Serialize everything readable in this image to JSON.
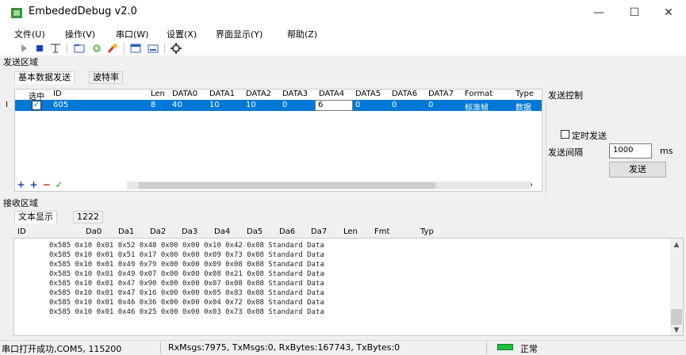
{
  "window": {
    "title": "EmbededDebug v2.0"
  },
  "menu": [
    "文件(U)",
    "操作(V)",
    "串口(W)",
    "设置(X)",
    "界面显示(Y)",
    "帮助(Z)"
  ],
  "toolbar": [
    "play-icon",
    "stop-icon",
    "antenna-icon",
    "open-folder-icon",
    "refresh-icon",
    "brush-icon",
    "window-icon",
    "window-minimize-icon",
    "settings-icon"
  ],
  "send": {
    "title": "发送区域",
    "tabs": [
      "基本数据发送",
      "波特率"
    ],
    "columns": [
      "选中",
      "ID",
      "Len",
      "DATA0",
      "DATA1",
      "DATA2",
      "DATA3",
      "DATA4",
      "DATA5",
      "DATA6",
      "DATA7",
      "Format",
      "Type"
    ],
    "row": {
      "marker": "I",
      "checked": true,
      "id": "605",
      "len": "8",
      "data": [
        "40",
        "10",
        "10",
        "0",
        "6",
        "0",
        "0",
        "0"
      ],
      "format": "标准帧",
      "type": "数据"
    }
  },
  "control": {
    "title": "发送控制",
    "timer_label": "定时发送",
    "interval_label": "发送间隔",
    "interval_value": "1000",
    "unit": "ms",
    "send_label": "发送"
  },
  "recv": {
    "title": "接收区域",
    "tabs": [
      "文本显示",
      "1222"
    ],
    "columns": [
      "ID",
      "Da0",
      "Da1",
      "Da2",
      "Da3",
      "Da4",
      "Da5",
      "Da6",
      "Da7",
      "Len",
      "Fmt",
      "Typ"
    ],
    "lines": [
      "0x585 0x10 0x01 0x52 0x48 0x00 0x00 0x10 0x42 0x08 Standard Data",
      "0x585 0x10 0x01 0x51 0x17 0x00 0x00 0x09 0x73 0x08 Standard Data",
      "0x585 0x10 0x01 0x49 0x79 0x00 0x00 0x09 0x08 0x08 Standard Data",
      "0x585 0x10 0x01 0x49 0x07 0x00 0x00 0x08 0x21 0x08 Standard Data",
      "0x585 0x10 0x01 0x47 0x90 0x00 0x00 0x07 0x08 0x08 Standard Data",
      "0x585 0x10 0x01 0x47 0x16 0x00 0x00 0x05 0x83 0x08 Standard Data",
      "0x585 0x10 0x01 0x46 0x36 0x00 0x00 0x04 0x72 0x08 Standard Data",
      "0x585 0x10 0x01 0x46 0x25 0x00 0x00 0x03 0x73 0x08 Standard Data"
    ]
  },
  "status": {
    "port": "串口打开成功,COM5, 115200",
    "stats": "RxMsgs:7975, TxMsgs:0, RxBytes:167743, TxBytes:0",
    "state": "正常"
  },
  "colors": {
    "selection": "#0078d7",
    "led": "#1fbf3a"
  }
}
